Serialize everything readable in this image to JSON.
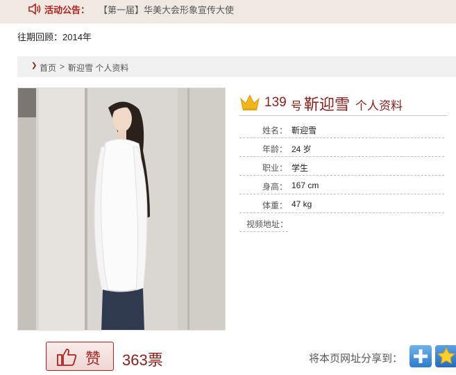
{
  "notice": {
    "label": "活动公告：",
    "text": "【第一届】华美大会形象宣传大使"
  },
  "archive": {
    "text": "往期回顾：2014年"
  },
  "breadcrumb": {
    "home": "首页",
    "separator": ">",
    "current": "靳迎雪 个人资料"
  },
  "profile": {
    "number": "139",
    "number_unit": "号",
    "name": "靳迎雪",
    "suffix": "个人资料",
    "fields": [
      {
        "label": "姓名：",
        "value": "靳迎雪"
      },
      {
        "label": "年龄：",
        "value": "24 岁"
      },
      {
        "label": "职业：",
        "value": "学生"
      },
      {
        "label": "身高：",
        "value": "167 cm"
      },
      {
        "label": "体重：",
        "value": "47 kg"
      },
      {
        "label": "视频地址：",
        "value": ""
      }
    ]
  },
  "vote": {
    "button_label": "赞",
    "count": "363票"
  },
  "share": {
    "text": "将本页网址分享到："
  },
  "colors": {
    "accent": "#8b1d18",
    "notice_red": "#b3201c",
    "notice_bg": "#efe9e2",
    "crumb_bg": "#f1f1f1"
  },
  "icons": {
    "notice": "speaker-icon",
    "crumb": "chevron-right-icon",
    "title": "crown-icon",
    "like": "thumbs-up-icon",
    "share_more": "plus-icon",
    "share_qzone": "star-icon"
  }
}
